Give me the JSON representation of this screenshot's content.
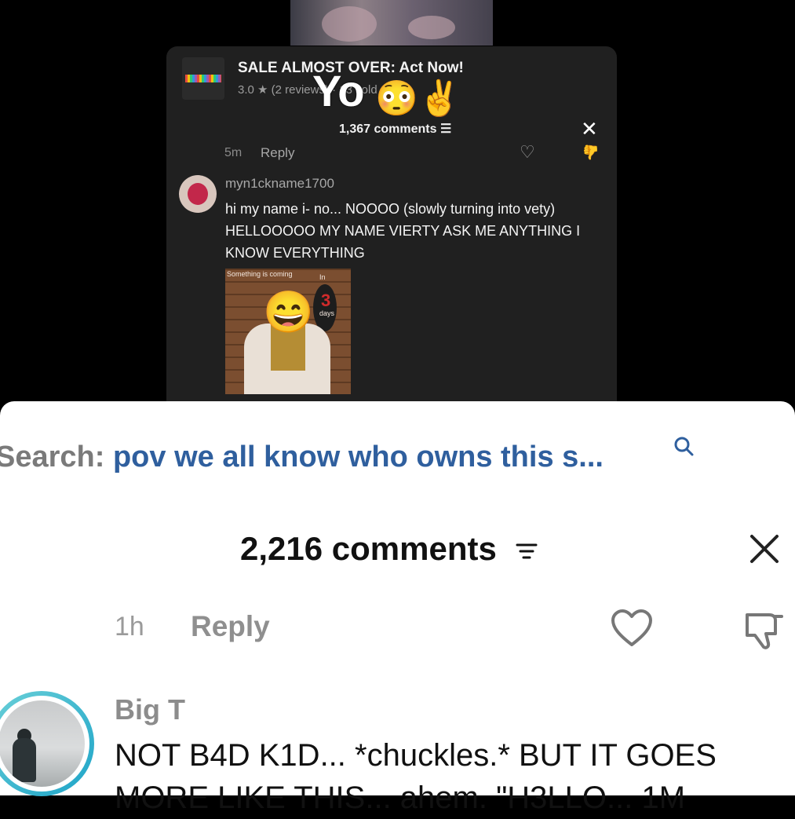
{
  "inner_ad": {
    "title": "SALE ALMOST OVER: Act Now!",
    "subtitle": "3.0 ★ (2 reviews) · 13 sold"
  },
  "overlay": {
    "text": "Yo",
    "emoji": "😳✌️"
  },
  "inner_comments": {
    "count_label": "1,367 comments",
    "close": "✕",
    "time": "5m",
    "reply": "Reply",
    "heart": "♡",
    "dislike": "👍",
    "user": "myn1ckname1700",
    "text": "hi my name i- no... NOOOO (slowly turning into vety) HELLOOOOO MY NAME VIERTY ASK ME ANYTHING I KNOW EVERYTHING",
    "image": {
      "text_left": "Something is coming",
      "text_in": "In",
      "number": "3",
      "text_days": "days",
      "face": "😄"
    }
  },
  "sheet": {
    "search_label": "Search:",
    "search_query": "pov we all know who owns this s...",
    "comments_count": "2,216 comments",
    "time": "1h",
    "reply": "Reply",
    "username": "Big T",
    "comment_text": "NOT B4D K1D... *chuckles.* BUT IT GOES MORE LIKE THIS... ahem. \"H3LLO... 1M"
  },
  "colors": {
    "search_query": "#2f5f9e",
    "avatar_ring": "#1ea4c8",
    "panel_bg": "#202020"
  },
  "icons": [
    "search-icon",
    "sort-icon",
    "close-icon",
    "heart-icon",
    "dislike-icon"
  ]
}
